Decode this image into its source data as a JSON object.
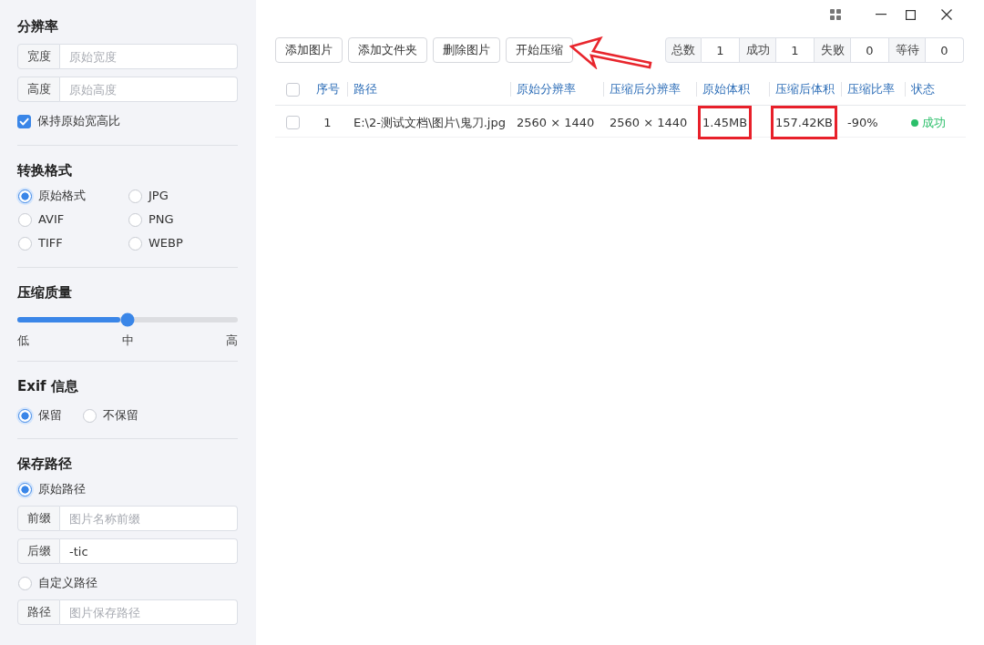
{
  "sidebar": {
    "resolution": {
      "title": "分辨率",
      "fields": [
        {
          "label": "宽度",
          "placeholder": "原始宽度"
        },
        {
          "label": "高度",
          "placeholder": "原始高度"
        }
      ],
      "keep_ratio": {
        "label": "保持原始宽高比",
        "checked": true
      }
    },
    "format": {
      "title": "转换格式",
      "options": [
        {
          "label": "原始格式",
          "selected": true
        },
        {
          "label": "JPG",
          "selected": false
        },
        {
          "label": "AVIF",
          "selected": false
        },
        {
          "label": "PNG",
          "selected": false
        },
        {
          "label": "TIFF",
          "selected": false
        },
        {
          "label": "WEBP",
          "selected": false
        }
      ]
    },
    "quality": {
      "title": "压缩质量",
      "level": 0.5,
      "marks": [
        "低",
        "中",
        "高"
      ]
    },
    "exif": {
      "title": "Exif 信息",
      "options": [
        {
          "label": "保留",
          "selected": true
        },
        {
          "label": "不保留",
          "selected": false
        }
      ]
    },
    "save_path": {
      "title": "保存路径",
      "items": [
        {
          "kind": "radio",
          "label": "原始路径",
          "selected": true
        },
        {
          "kind": "field",
          "label": "前缀",
          "placeholder": "图片名称前缀"
        },
        {
          "kind": "field",
          "label": "后缀",
          "value": "-tic"
        },
        {
          "kind": "radio",
          "label": "自定义路径",
          "selected": false
        },
        {
          "kind": "field",
          "label": "路径",
          "placeholder": "图片保存路径"
        }
      ]
    }
  },
  "toolbar": {
    "buttons": [
      {
        "label": "添加图片",
        "arrow_mark": false
      },
      {
        "label": "添加文件夹",
        "arrow_mark": false
      },
      {
        "label": "删除图片",
        "arrow_mark": false
      },
      {
        "label": "开始压缩",
        "arrow_mark": true
      }
    ],
    "stats": [
      {
        "label": "总数",
        "value": "1"
      },
      {
        "label": "成功",
        "value": "1"
      },
      {
        "label": "失败",
        "value": "0"
      },
      {
        "label": "等待",
        "value": "0"
      }
    ]
  },
  "table": {
    "all_selected": false,
    "columns": [
      "序号",
      "路径",
      "原始分辨率",
      "压缩后分辨率",
      "原始体积",
      "压缩后体积",
      "压缩比率",
      "状态"
    ],
    "rows": [
      {
        "selected": false,
        "cells": [
          {
            "text": "1",
            "boxed": false
          },
          {
            "text": "E:\\2-测试文档\\图片\\鬼刀.jpg",
            "boxed": false
          },
          {
            "text": "2560 × 1440",
            "boxed": false
          },
          {
            "text": "2560 × 1440",
            "boxed": false
          },
          {
            "text": "1.45MB",
            "boxed": true
          },
          {
            "text": "157.42KB",
            "boxed": true
          },
          {
            "text": "-90%",
            "boxed": false
          }
        ],
        "status": {
          "text": "成功",
          "color": "#2bbf6a"
        }
      }
    ]
  }
}
